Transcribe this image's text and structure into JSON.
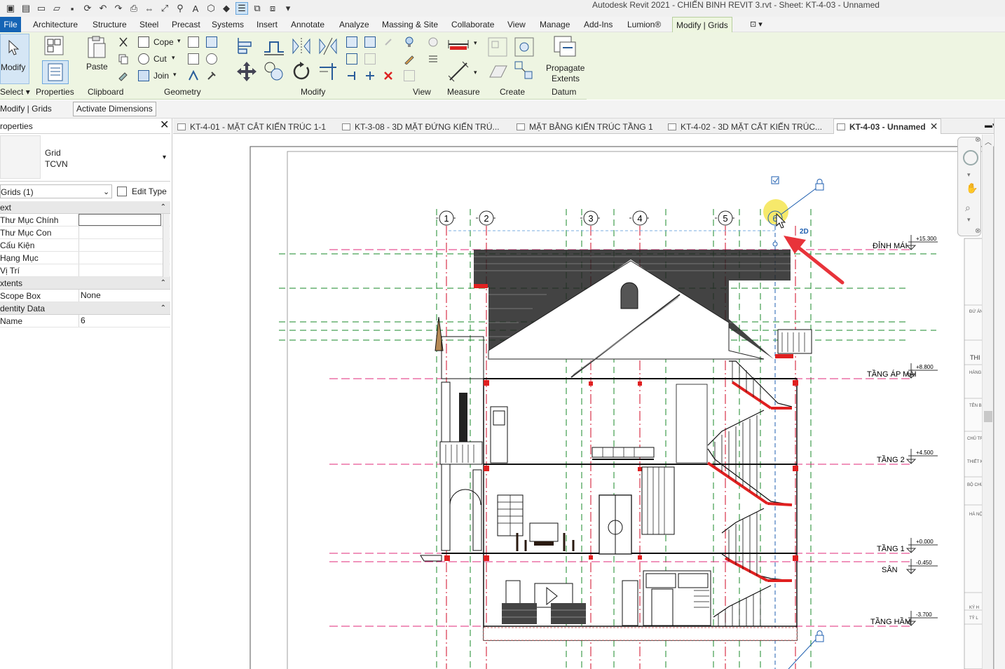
{
  "app": {
    "title": "Autodesk Revit 2021 - CHIẾN BINH REVIT 3.rvt - Sheet: KT-4-03 - Unnamed"
  },
  "menu": {
    "tabs": [
      "File",
      "Architecture",
      "Structure",
      "Steel",
      "Precast",
      "Systems",
      "Insert",
      "Annotate",
      "Analyze",
      "Massing & Site",
      "Collaborate",
      "View",
      "Manage",
      "Add-Ins",
      "Lumion®",
      "Modify | Grids"
    ]
  },
  "ribbon": {
    "modify_label": "Modify",
    "select_label": "Select",
    "properties_label": "Properties",
    "paste_label": "Paste",
    "clipboard_label": "Clipboard",
    "cope_label": "Cope",
    "cut_label": "Cut",
    "join_label": "Join",
    "geometry_label": "Geometry",
    "modify_panel_label": "Modify",
    "view_label": "View",
    "measure_label": "Measure",
    "create_label": "Create",
    "propagate_line1": "Propagate",
    "propagate_line2": "Extents",
    "datum_label": "Datum"
  },
  "options_bar": {
    "context": "Modify | Grids",
    "activate_dimensions": "Activate Dimensions"
  },
  "properties": {
    "title": "roperties",
    "type_line1": "Grid",
    "type_line2": "TCVN",
    "selector": "Grids (1)",
    "edit_type": "Edit Type",
    "sections": [
      {
        "name": "ext",
        "rows": [
          {
            "key": "Thư Mục Chính",
            "value": ""
          },
          {
            "key": "Thư Mục Con",
            "value": ""
          },
          {
            "key": "Cấu Kiện",
            "value": ""
          },
          {
            "key": "Hạng Mục",
            "value": ""
          },
          {
            "key": "Vị Trí",
            "value": ""
          }
        ]
      },
      {
        "name": "xtents",
        "rows": [
          {
            "key": "Scope Box",
            "value": "None"
          }
        ]
      },
      {
        "name": "dentity Data",
        "rows": [
          {
            "key": "Name",
            "value": "6"
          }
        ]
      }
    ]
  },
  "doc_tabs": [
    {
      "label": "KT-4-01 - MẶT CẮT KIẾN TRÚC 1-1"
    },
    {
      "label": "KT-3-08 - 3D MẶT ĐỨNG KIẾN TRÚ..."
    },
    {
      "label": "MẶT BẰNG KIẾN TRÚC TẦNG 1"
    },
    {
      "label": "KT-4-02 - 3D MẶT CẮT KIẾN TRÚC..."
    },
    {
      "label": "KT-4-03 - Unnamed",
      "active": true
    }
  ],
  "drawing": {
    "grid_bubbles": [
      "1",
      "2",
      "3",
      "4",
      "5",
      "6"
    ],
    "tag_2d": "2D",
    "levels": [
      {
        "name": "ĐỈNH MÁI",
        "elevation": "+15.300"
      },
      {
        "name": "TẦNG ÁP MÁI",
        "elevation": "+8.800"
      },
      {
        "name": "TẦNG 2",
        "elevation": "+4.500"
      },
      {
        "name": "TẦNG 1",
        "elevation": "+0.000"
      },
      {
        "name": "SÂN",
        "elevation": "-0.450"
      },
      {
        "name": "TẦNG HẦM",
        "elevation": "-3.700"
      }
    ],
    "titleblock_snippets": [
      "ĐỨ ÁN",
      "THI",
      "HÀNG",
      "TÊN B",
      "CHỦ TR",
      "THIẾT K",
      "BỘ CHỦ",
      "HÀ NỘ",
      "KÝ H",
      "TỶ L"
    ]
  },
  "colors": {
    "file_tab": "#1564b5",
    "ribbon_bg": "#eef5e2",
    "grid_line": "#d6203a",
    "level_line": "#e0287a",
    "ref_plane": "#1a8a2a",
    "selection_highlight": "#f3e23a",
    "arrow": "#e8333a"
  }
}
